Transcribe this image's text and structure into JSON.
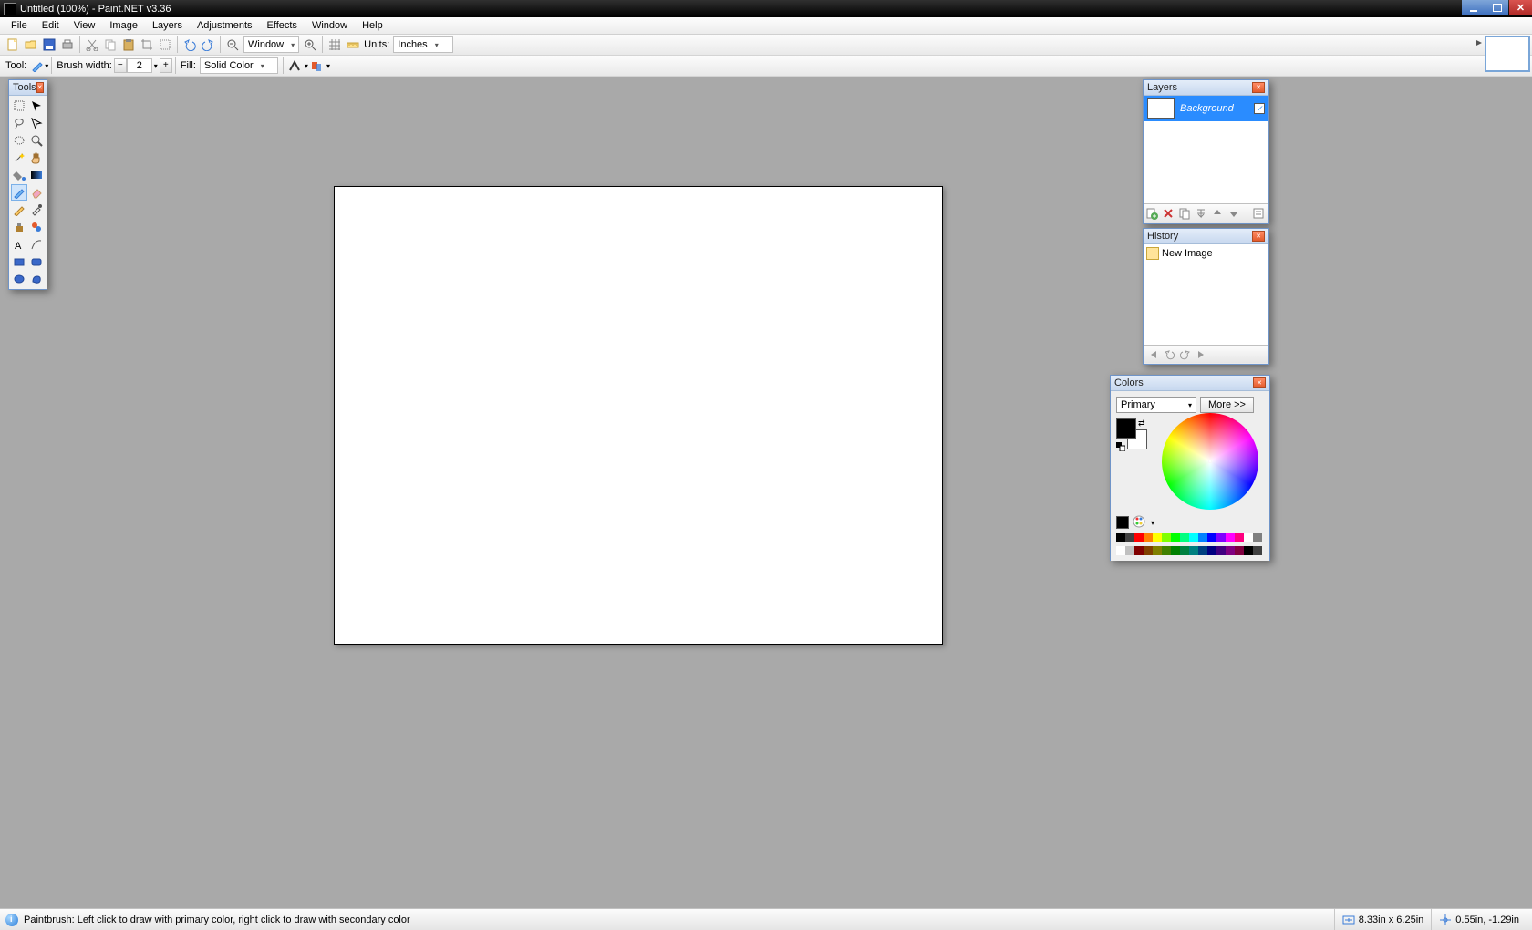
{
  "titlebar": {
    "text": "Untitled (100%) - Paint.NET v3.36"
  },
  "menu": {
    "items": [
      "File",
      "Edit",
      "View",
      "Image",
      "Layers",
      "Adjustments",
      "Effects",
      "Window",
      "Help"
    ]
  },
  "toolbar1": {
    "window_label": "Window",
    "units_label": "Units:",
    "units_value": "Inches"
  },
  "toolbar2": {
    "tool_label": "Tool:",
    "brush_label": "Brush width:",
    "brush_value": "2",
    "fill_label": "Fill:",
    "fill_value": "Solid Color"
  },
  "panels": {
    "tools": {
      "title": "Tools"
    },
    "layers": {
      "title": "Layers",
      "item_label": "Background"
    },
    "history": {
      "title": "History",
      "item_label": "New Image"
    },
    "colors": {
      "title": "Colors",
      "primary_label": "Primary",
      "more_label": "More >>"
    }
  },
  "palette": [
    "#000000",
    "#404040",
    "#ff0000",
    "#ff8000",
    "#ffff00",
    "#80ff00",
    "#00ff00",
    "#00ff80",
    "#00ffff",
    "#0080ff",
    "#0000ff",
    "#8000ff",
    "#ff00ff",
    "#ff0080",
    "#ffffff",
    "#808080"
  ],
  "palette2": [
    "#ffffff",
    "#c0c0c0",
    "#800000",
    "#804000",
    "#808000",
    "#408000",
    "#008000",
    "#008040",
    "#008080",
    "#004080",
    "#000080",
    "#400080",
    "#800080",
    "#800040",
    "#000000",
    "#404040"
  ],
  "status": {
    "hint": "Paintbrush: Left click to draw with primary color, right click to draw with secondary color",
    "dims": "8.33in x 6.25in",
    "coords": "0.55in, -1.29in"
  }
}
